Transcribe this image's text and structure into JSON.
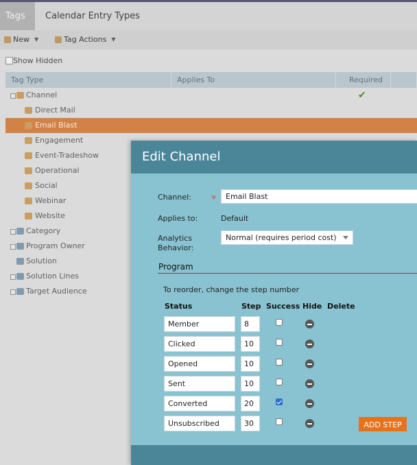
{
  "topbar": {
    "tab_tags": "Tags",
    "tab_calendar": "Calendar Entry Types"
  },
  "toolbar": {
    "new_label": "New",
    "actions_label": "Tag Actions"
  },
  "show_hidden": "Show Hidden",
  "grid": {
    "headers": {
      "tag_type": "Tag Type",
      "applies_to": "Applies To",
      "required": "Required"
    },
    "rows": [
      {
        "label": "Channel"
      },
      {
        "label": "Direct Mail"
      },
      {
        "label": "Email Blast"
      },
      {
        "label": "Engagement"
      },
      {
        "label": "Event-Tradeshow"
      },
      {
        "label": "Operational"
      },
      {
        "label": "Social"
      },
      {
        "label": "Webinar"
      },
      {
        "label": "Website"
      },
      {
        "label": "Category"
      },
      {
        "label": "Program Owner"
      },
      {
        "label": "Solution"
      },
      {
        "label": "Solution Lines"
      },
      {
        "label": "Target Audience"
      }
    ],
    "check_icon": "checkmark-icon"
  },
  "modal": {
    "title": "Edit Channel",
    "channel_label": "Channel:",
    "channel_value": "Email Blast",
    "applies_label": "Applies to:",
    "applies_value": "Default",
    "analytics_label_1": "Analytics",
    "analytics_label_2": "Behavior:",
    "analytics_value": "Normal (requires period cost)",
    "program_title": "Program",
    "reorder_hint": "To reorder, change the step number",
    "col_status": "Status",
    "col_step": "Step",
    "col_success": "Success",
    "col_hide": "Hide",
    "col_delete": "Delete",
    "steps": [
      {
        "status": "Member",
        "step": "8",
        "success": false
      },
      {
        "status": "Clicked",
        "step": "10",
        "success": false
      },
      {
        "status": "Opened",
        "step": "10",
        "success": false
      },
      {
        "status": "Sent",
        "step": "10",
        "success": false
      },
      {
        "status": "Converted",
        "step": "20",
        "success": true
      },
      {
        "status": "Unsubscribed",
        "step": "30",
        "success": false
      }
    ],
    "add_step_label": "ADD STEP"
  },
  "colors": {
    "accent": "#e8721c",
    "modal_header": "#4a8598",
    "modal_body": "#89c3d1",
    "selected_row": "#e08b4c"
  }
}
